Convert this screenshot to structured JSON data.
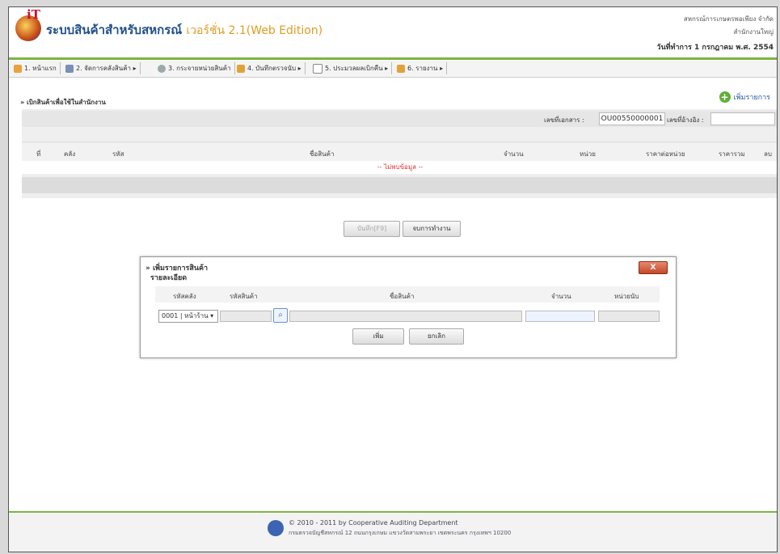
{
  "app": {
    "title_main": "ระบบสินค้าสำหรับสหกรณ์",
    "title_version": "เวอร์ชั่น 2.1(Web Edition)",
    "org_line1": "สหกรณ์การเกษตรพอเพียง จำกัด",
    "org_line2": "สำนักงานใหญ่",
    "today_label": "วันที่ทำการ 1 กรกฎาคม พ.ศ. 2554"
  },
  "menu": [
    {
      "label": "1. หน้าแรก"
    },
    {
      "label": "2. จัดการคลังสินค้า ▸"
    },
    {
      "label": "3. กระจายหน่วยสินค้า"
    },
    {
      "label": "4. บันทึกตรวจนับ ▸"
    },
    {
      "label": "5. ประมวลผลเบิกคืน ▸"
    },
    {
      "label": "6. รายงาน ▸"
    }
  ],
  "panel": {
    "title": "» เบิกสินค้าเพื่อใช้ในสำนักงาน",
    "add_label": "เพิ่มรายการ",
    "doc_no_label": "เลขที่เอกสาร :",
    "doc_no_value": "OU00550000001",
    "ref_no_label": "เลขที่อ้างอิง :",
    "ref_no_value": ""
  },
  "table": {
    "columns": [
      "ที่",
      "คลัง",
      "รหัส",
      "ชื่อสินค้า",
      "จำนวน",
      "หน่วย",
      "ราคาต่อหน่วย",
      "ราคารวม",
      "ลบ"
    ],
    "no_data": "-- ไม่พบข้อมูล --"
  },
  "actions": {
    "save_label": "บันทึก[F9]",
    "end_label": "จบการทำงาน"
  },
  "dialog": {
    "title": "» เพิ่มรายการสินค้า",
    "close_label": "X",
    "subtitle": "รายละเอียด",
    "columns": [
      "รหัสคลัง",
      "รหัสสินค้า",
      "ชื่อสินค้า",
      "จำนวน",
      "หน่วยนับ"
    ],
    "warehouse_value": "0001 | หน้าร้าน ▾",
    "add_label": "เพิ่ม",
    "cancel_label": "ยกเลิก"
  },
  "footer": {
    "line1": "© 2010 - 2011  by Cooperative Auditing Department",
    "line2": "กรมตรวจบัญชีสหกรณ์ 12 ถนนกรุงเกษม แขวงวัดสามพระยา เขตพระนคร กรุงเทพฯ 10200"
  }
}
